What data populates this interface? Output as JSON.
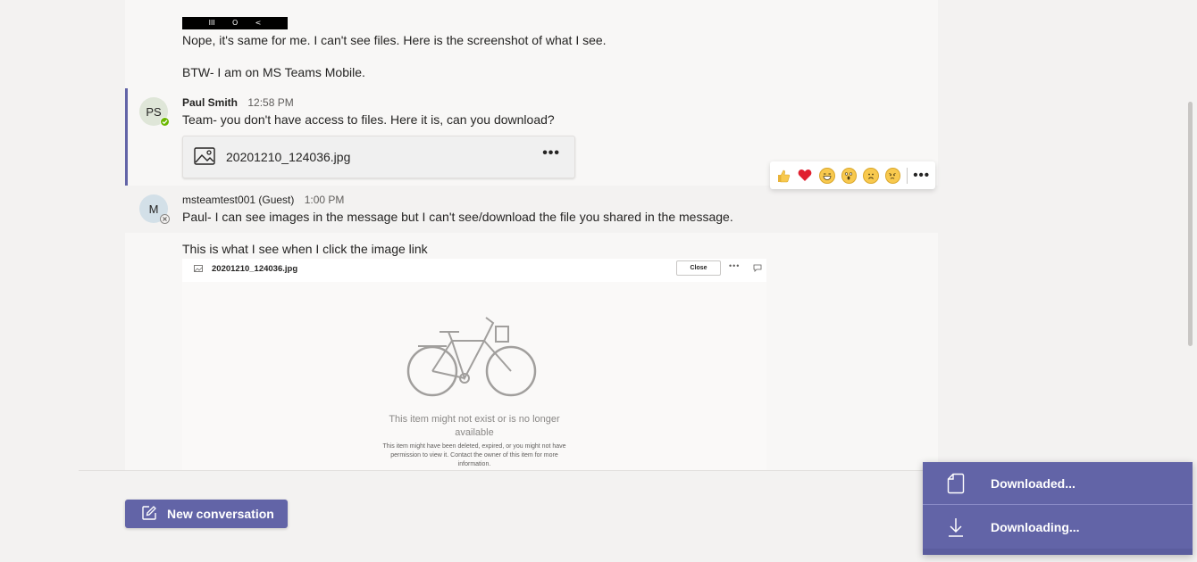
{
  "thread": {
    "prev_message": {
      "phone_nav": [
        "III",
        "O",
        "<"
      ],
      "line1": "Nope, it's same for me. I can't see files. Here is the screenshot of what I see.",
      "line2": "BTW- I am on MS Teams Mobile."
    },
    "post_paul": {
      "avatar_initials": "PS",
      "author": "Paul Smith",
      "time": "12:58 PM",
      "text": "Team- you don't have access to files. Here it is, can you download?",
      "attachment": {
        "file_name": "20201210_124036.jpg",
        "more": "•••"
      }
    },
    "post_guest": {
      "avatar_initials": "M",
      "author": "msteamtest001 (Guest)",
      "time": "1:00 PM",
      "text": "Paul- I can see images in the message but I can't see/download the file you shared in the message.",
      "followup": "This is what I see when I click the image link",
      "preview": {
        "file_name": "20201210_124036.jpg",
        "close_label": "Close",
        "more": "•••",
        "title": "This item might not exist or is no longer available",
        "detail": "This item might have been deleted, expired, or you might not have permission to view it. Contact the owner of this item for more information."
      }
    }
  },
  "reactions": {
    "items": [
      "like-icon",
      "heart-icon",
      "laugh-icon",
      "surprised-icon",
      "sad-icon",
      "angry-icon"
    ],
    "more": "•••"
  },
  "compose": {
    "new_conversation_label": "New conversation"
  },
  "downloads": {
    "items": [
      {
        "label": "Downloaded...",
        "icon": "document-icon"
      },
      {
        "label": "Downloading...",
        "icon": "download-icon"
      }
    ]
  },
  "colors": {
    "brand": "#6264a7",
    "presence_available": "#6bb700"
  }
}
